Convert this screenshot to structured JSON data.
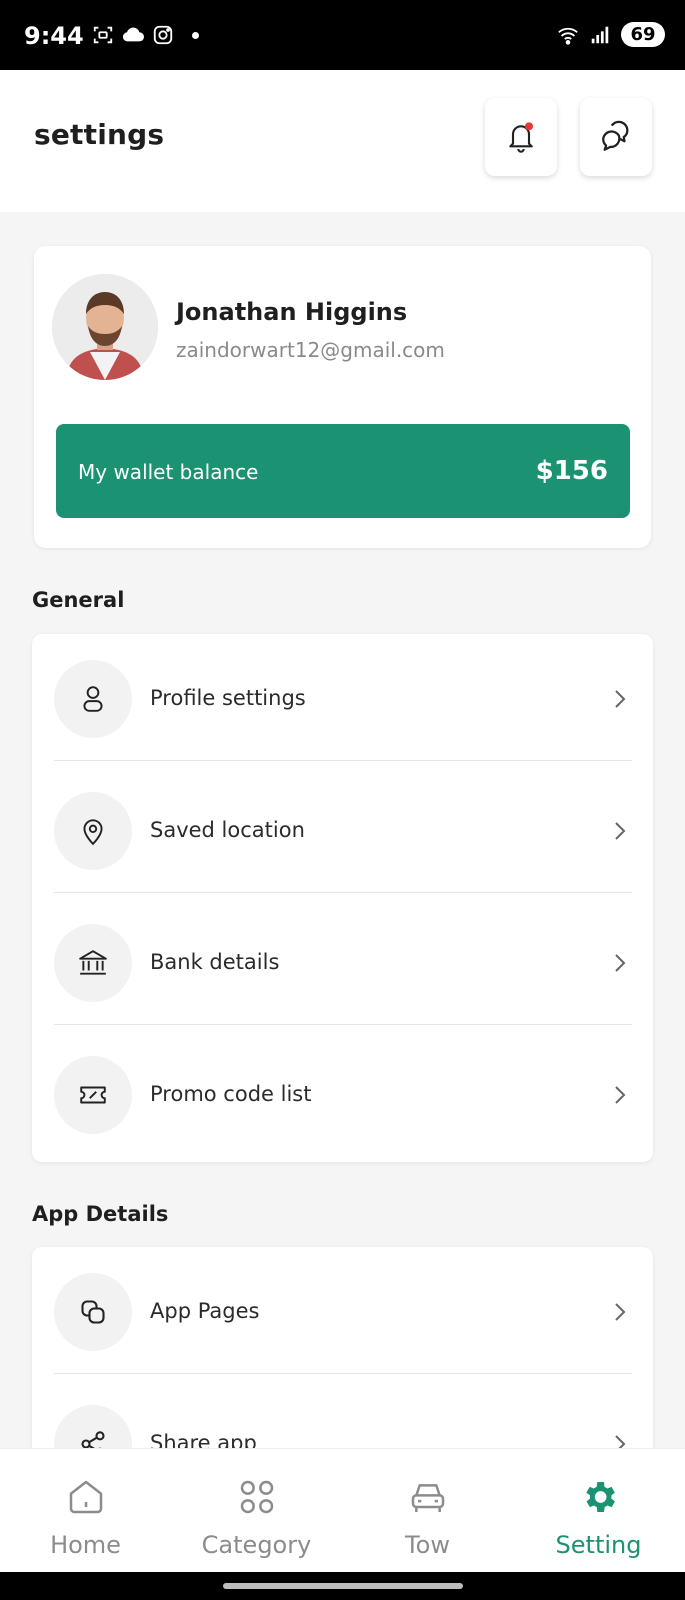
{
  "status_bar": {
    "time": "9:44",
    "battery": "69",
    "icons_left": [
      "screenshot-icon",
      "cloud-icon",
      "instagram-icon"
    ],
    "icons_right": [
      "wifi-icon",
      "signal-icon",
      "battery-icon"
    ]
  },
  "header": {
    "title": "settings",
    "notification_icon": "bell-icon",
    "chat_icon": "chat-icon",
    "notification_dot_color": "#e53935"
  },
  "profile": {
    "name": "Jonathan Higgins",
    "email": "zaindorwart12@gmail.com",
    "wallet_label": "My wallet balance",
    "wallet_amount": "$156"
  },
  "general": {
    "title": "General",
    "items": [
      {
        "label": "Profile settings",
        "icon": "user-icon"
      },
      {
        "label": "Saved location",
        "icon": "location-pin-icon"
      },
      {
        "label": "Bank details",
        "icon": "bank-icon"
      },
      {
        "label": "Promo code list",
        "icon": "ticket-icon"
      }
    ]
  },
  "app_details": {
    "title": "App Details",
    "items": [
      {
        "label": "App Pages",
        "icon": "copy-icon"
      },
      {
        "label": "Share app",
        "icon": "share-icon"
      }
    ]
  },
  "bottom_nav": {
    "items": [
      {
        "label": "Home",
        "icon": "home-icon",
        "active": false
      },
      {
        "label": "Category",
        "icon": "grid-icon",
        "active": false
      },
      {
        "label": "Tow",
        "icon": "car-icon",
        "active": false
      },
      {
        "label": "Setting",
        "icon": "gear-icon",
        "active": true
      }
    ]
  },
  "colors": {
    "accent": "#1b9272",
    "background": "#f5f5f5",
    "muted_text": "#8a8a8a"
  }
}
